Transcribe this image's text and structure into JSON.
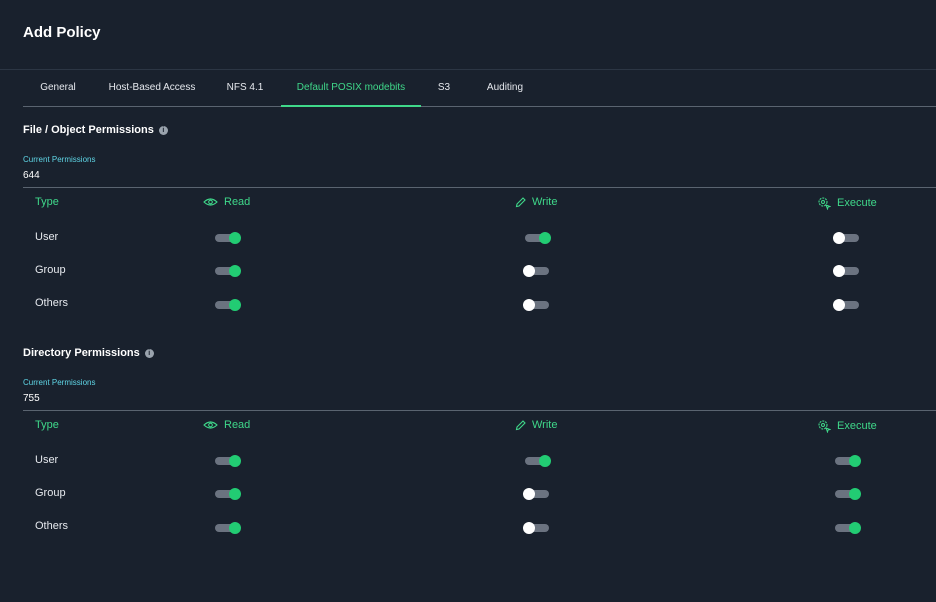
{
  "window": {
    "title": "Add Policy"
  },
  "tabs": [
    {
      "label": "General"
    },
    {
      "label": "Host-Based Access"
    },
    {
      "label": "NFS 4.1"
    },
    {
      "label": "Default POSIX modebits",
      "active": true
    },
    {
      "label": "S3"
    },
    {
      "label": "Auditing"
    }
  ],
  "colors": {
    "accent": "#3fd88a",
    "background": "#19212d",
    "toggle_on": "#22cc73",
    "label_cyan": "#5fd6e6"
  },
  "file_permissions": {
    "title": "File / Object Permissions",
    "info_icon": "info-icon",
    "current_label": "Current Permissions",
    "current_value": "644",
    "columns": {
      "type": "Type",
      "read": "Read",
      "write": "Write",
      "execute": "Execute"
    },
    "rows": [
      {
        "label": "User",
        "read": true,
        "write": true,
        "execute": false
      },
      {
        "label": "Group",
        "read": true,
        "write": false,
        "execute": false
      },
      {
        "label": "Others",
        "read": true,
        "write": false,
        "execute": false
      }
    ]
  },
  "directory_permissions": {
    "title": "Directory Permissions",
    "info_icon": "info-icon",
    "current_label": "Current Permissions",
    "current_value": "755",
    "columns": {
      "type": "Type",
      "read": "Read",
      "write": "Write",
      "execute": "Execute"
    },
    "rows": [
      {
        "label": "User",
        "read": true,
        "write": true,
        "execute": true
      },
      {
        "label": "Group",
        "read": true,
        "write": false,
        "execute": true
      },
      {
        "label": "Others",
        "read": true,
        "write": false,
        "execute": true
      }
    ]
  }
}
